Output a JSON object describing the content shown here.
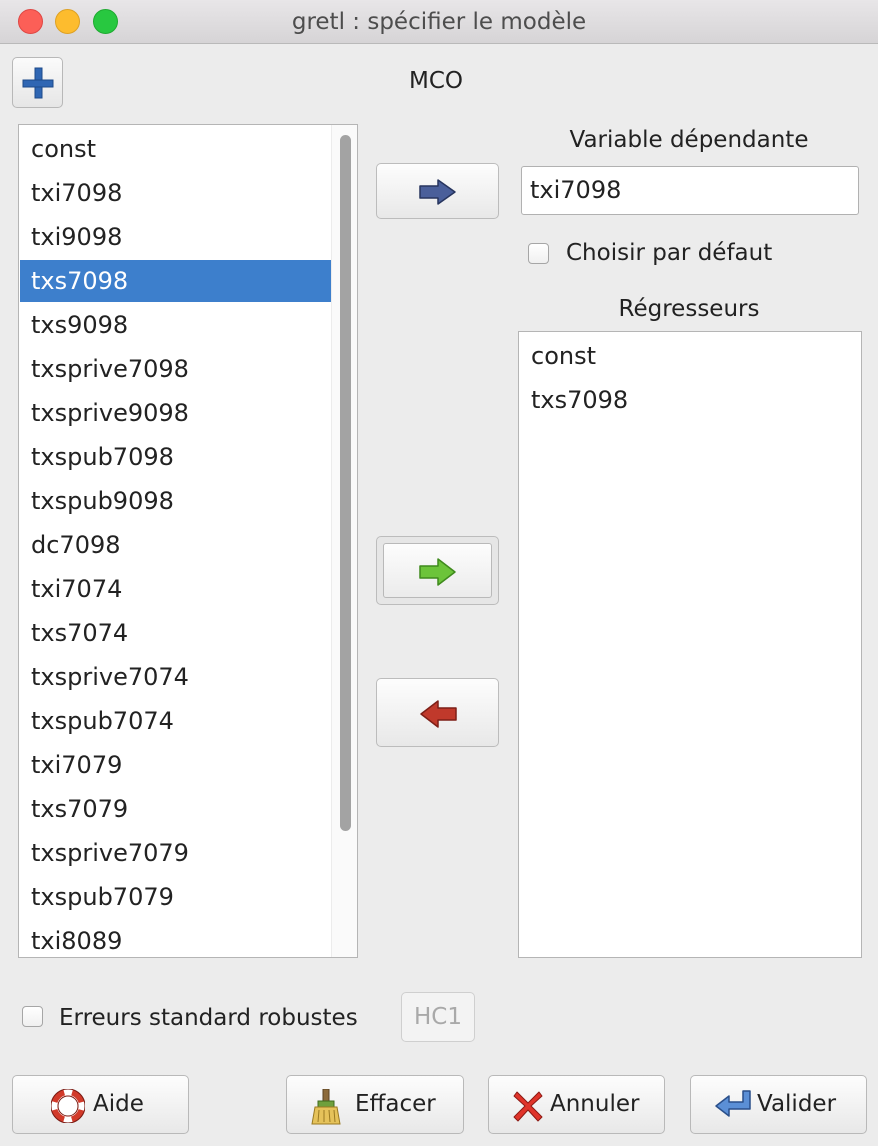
{
  "window": {
    "title": "gretl : spécifier le modèle"
  },
  "model": {
    "name": "MCO"
  },
  "variables": {
    "items": [
      "const",
      "txi7098",
      "txi9098",
      "txs7098",
      "txs9098",
      "txsprive7098",
      "txsprive9098",
      "txspub7098",
      "txspub9098",
      "dc7098",
      "txi7074",
      "txs7074",
      "txsprive7074",
      "txspub7074",
      "txi7079",
      "txs7079",
      "txsprive7079",
      "txspub7079",
      "txi8089"
    ],
    "selected": "txs7098"
  },
  "dependent": {
    "label": "Variable dépendante",
    "value": "txi7098",
    "default_checkbox_label": "Choisir par défaut",
    "default_checked": false
  },
  "regressors": {
    "label": "Régresseurs",
    "items": [
      "const",
      "txs7098"
    ]
  },
  "robust": {
    "label": "Erreurs standard robustes",
    "checked": false,
    "hc_label": "HC1"
  },
  "buttons": {
    "help": "Aide",
    "clear": "Effacer",
    "cancel": "Annuler",
    "ok": "Valider"
  },
  "icons": {
    "add": "plus-icon",
    "set_dependent": "arrow-right-blue-icon",
    "add_regressor": "arrow-right-green-icon",
    "remove_regressor": "arrow-left-red-icon",
    "help": "lifebuoy-icon",
    "clear": "broom-icon",
    "cancel": "red-x-icon",
    "ok": "return-arrow-icon"
  },
  "colors": {
    "selection": "#3d7fcc",
    "arrow_blue": "#4a5f9a",
    "arrow_green": "#6cc43a",
    "arrow_red": "#c0392b"
  }
}
